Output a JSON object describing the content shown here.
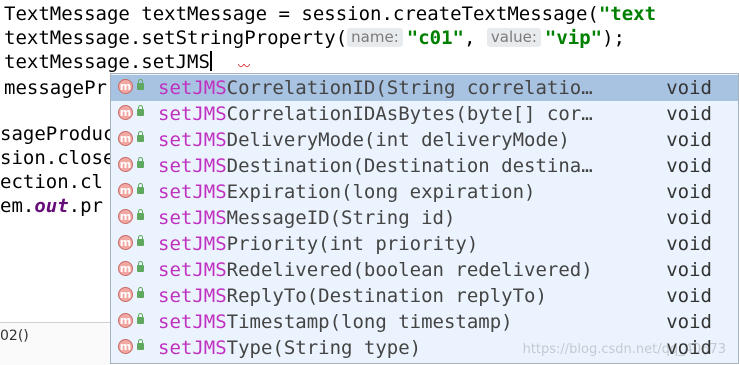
{
  "editor": {
    "line1": {
      "prefix": "TextMessage textMessage = session.createTextMessage(",
      "string": "\"text"
    },
    "line2": {
      "code": "textMessage.setStringProperty(",
      "hint1": "name:",
      "arg1": "\"c01\"",
      "sep": ",",
      "hint2": "value:",
      "arg2": "\"vip\"",
      "suffix": ");"
    },
    "line3": {
      "code": "textMessage.setJMS"
    },
    "line4": {
      "code": "messagePr"
    },
    "line6": {
      "code": "sageProduc"
    },
    "line7": {
      "code": "sion.close"
    },
    "line8": {
      "code": "ection.cl"
    },
    "line9": {
      "code": "em.",
      "italic": "out",
      "rest": ".pr"
    },
    "status": "02()"
  },
  "completion": {
    "typed_prefix": "setJMS",
    "items": [
      {
        "rest": "CorrelationID(String correlatio…",
        "ret": "void",
        "selected": true
      },
      {
        "rest": "CorrelationIDAsBytes(byte[] cor…",
        "ret": "void"
      },
      {
        "rest": "DeliveryMode(int deliveryMode)",
        "ret": "void"
      },
      {
        "rest": "Destination(Destination destina…",
        "ret": "void"
      },
      {
        "rest": "Expiration(long expiration)",
        "ret": "void"
      },
      {
        "rest": "MessageID(String id)",
        "ret": "void"
      },
      {
        "rest": "Priority(int priority)",
        "ret": "void"
      },
      {
        "rest": "Redelivered(boolean redelivered)",
        "ret": "void"
      },
      {
        "rest": "ReplyTo(Destination replyTo)",
        "ret": "void"
      },
      {
        "rest": "Timestamp(long timestamp)",
        "ret": "void"
      },
      {
        "rest": "Type(String type)",
        "ret": "void"
      }
    ],
    "icon_letter": "m"
  },
  "watermark": "https://blog.csdn.net/qq_40673"
}
